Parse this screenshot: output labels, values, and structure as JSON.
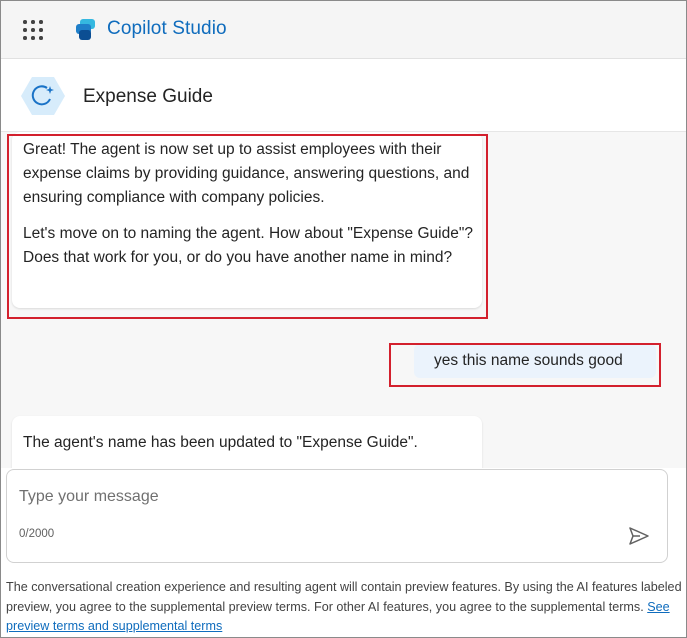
{
  "app": {
    "name": "Copilot Studio",
    "brand_color": "#0f6cbd"
  },
  "agent": {
    "title": "Expense Guide"
  },
  "messages": [
    {
      "role": "bot",
      "paragraphs": [
        "Great! The agent is now set up to assist employees with their expense claims by providing guidance, answering questions, and ensuring compliance with company policies.",
        "Let's move on to naming the agent. How about \"Expense Guide\"? Does that work for you, or do you have another name in mind?"
      ]
    },
    {
      "role": "user",
      "text": "yes this name sounds good"
    },
    {
      "role": "bot",
      "paragraphs": [
        "The agent's name has been updated to \"Expense Guide\"."
      ]
    }
  ],
  "composer": {
    "placeholder": "Type your message",
    "value": "",
    "counter": "0/2000"
  },
  "disclaimer": {
    "text": "The conversational creation experience and resulting agent will contain preview features. By using the AI features labeled preview, you agree to the supplemental preview terms. For other AI features, you agree to the supplemental terms.",
    "link": "See preview terms and supplemental terms"
  },
  "icons": {
    "app_launcher": "waffle-icon",
    "brand": "copilot-studio-logo",
    "agent": "agent-avatar-icon",
    "send": "send-icon"
  },
  "colors": {
    "highlight_box": "#d3202d",
    "user_bubble": "#ebf3fc",
    "link": "#0f6cbd"
  }
}
